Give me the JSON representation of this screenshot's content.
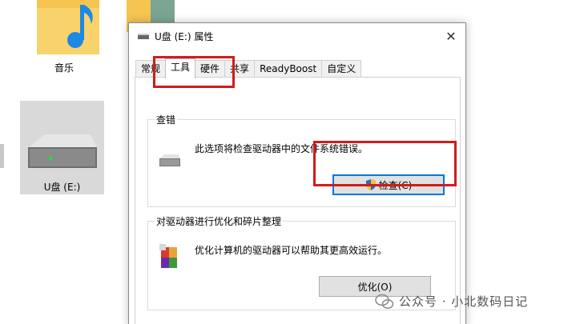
{
  "explorer": {
    "music_folder_label": "音乐",
    "drive_label": "U盘 (E:)"
  },
  "dialog": {
    "title": "U盘 (E:) 属性",
    "close_symbol": "✕",
    "tabs": [
      {
        "label": "常规",
        "active": false
      },
      {
        "label": "工具",
        "active": true
      },
      {
        "label": "硬件",
        "active": false
      },
      {
        "label": "共享",
        "active": false
      },
      {
        "label": "ReadyBoost",
        "active": false
      },
      {
        "label": "自定义",
        "active": false
      }
    ],
    "error_check": {
      "title": "查错",
      "description": "此选项将检查驱动器中的文件系统错误。",
      "button_label": "检查(C)"
    },
    "optimize": {
      "title": "对驱动器进行优化和碎片整理",
      "description": "优化计算机的驱动器可以帮助其更高效运行。",
      "button_label": "优化(O)"
    }
  },
  "watermark": {
    "text": "公众号 · 小北数码日记"
  },
  "colors": {
    "highlight": "#d21b1b",
    "accent": "#0078d7",
    "button_bg": "#e1e1e1"
  },
  "icons": {
    "title": "usb-drive-icon",
    "error_check": "drive-icon",
    "optimize": "defrag-icon",
    "check_button": "uac-shield-icon",
    "watermark": "wechat-icon"
  }
}
